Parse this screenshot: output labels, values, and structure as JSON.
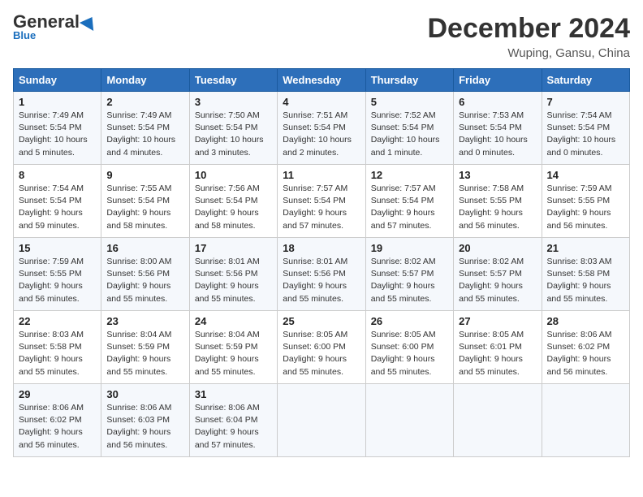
{
  "header": {
    "logo_general": "General",
    "logo_blue": "Blue",
    "month_title": "December 2024",
    "location": "Wuping, Gansu, China"
  },
  "days_of_week": [
    "Sunday",
    "Monday",
    "Tuesday",
    "Wednesday",
    "Thursday",
    "Friday",
    "Saturday"
  ],
  "weeks": [
    [
      {
        "day": "1",
        "sunrise": "7:49 AM",
        "sunset": "5:54 PM",
        "daylight": "10 hours and 5 minutes."
      },
      {
        "day": "2",
        "sunrise": "7:49 AM",
        "sunset": "5:54 PM",
        "daylight": "10 hours and 4 minutes."
      },
      {
        "day": "3",
        "sunrise": "7:50 AM",
        "sunset": "5:54 PM",
        "daylight": "10 hours and 3 minutes."
      },
      {
        "day": "4",
        "sunrise": "7:51 AM",
        "sunset": "5:54 PM",
        "daylight": "10 hours and 2 minutes."
      },
      {
        "day": "5",
        "sunrise": "7:52 AM",
        "sunset": "5:54 PM",
        "daylight": "10 hours and 1 minute."
      },
      {
        "day": "6",
        "sunrise": "7:53 AM",
        "sunset": "5:54 PM",
        "daylight": "10 hours and 0 minutes."
      },
      {
        "day": "7",
        "sunrise": "7:54 AM",
        "sunset": "5:54 PM",
        "daylight": "10 hours and 0 minutes."
      }
    ],
    [
      {
        "day": "8",
        "sunrise": "7:54 AM",
        "sunset": "5:54 PM",
        "daylight": "9 hours and 59 minutes."
      },
      {
        "day": "9",
        "sunrise": "7:55 AM",
        "sunset": "5:54 PM",
        "daylight": "9 hours and 58 minutes."
      },
      {
        "day": "10",
        "sunrise": "7:56 AM",
        "sunset": "5:54 PM",
        "daylight": "9 hours and 58 minutes."
      },
      {
        "day": "11",
        "sunrise": "7:57 AM",
        "sunset": "5:54 PM",
        "daylight": "9 hours and 57 minutes."
      },
      {
        "day": "12",
        "sunrise": "7:57 AM",
        "sunset": "5:54 PM",
        "daylight": "9 hours and 57 minutes."
      },
      {
        "day": "13",
        "sunrise": "7:58 AM",
        "sunset": "5:55 PM",
        "daylight": "9 hours and 56 minutes."
      },
      {
        "day": "14",
        "sunrise": "7:59 AM",
        "sunset": "5:55 PM",
        "daylight": "9 hours and 56 minutes."
      }
    ],
    [
      {
        "day": "15",
        "sunrise": "7:59 AM",
        "sunset": "5:55 PM",
        "daylight": "9 hours and 56 minutes."
      },
      {
        "day": "16",
        "sunrise": "8:00 AM",
        "sunset": "5:56 PM",
        "daylight": "9 hours and 55 minutes."
      },
      {
        "day": "17",
        "sunrise": "8:01 AM",
        "sunset": "5:56 PM",
        "daylight": "9 hours and 55 minutes."
      },
      {
        "day": "18",
        "sunrise": "8:01 AM",
        "sunset": "5:56 PM",
        "daylight": "9 hours and 55 minutes."
      },
      {
        "day": "19",
        "sunrise": "8:02 AM",
        "sunset": "5:57 PM",
        "daylight": "9 hours and 55 minutes."
      },
      {
        "day": "20",
        "sunrise": "8:02 AM",
        "sunset": "5:57 PM",
        "daylight": "9 hours and 55 minutes."
      },
      {
        "day": "21",
        "sunrise": "8:03 AM",
        "sunset": "5:58 PM",
        "daylight": "9 hours and 55 minutes."
      }
    ],
    [
      {
        "day": "22",
        "sunrise": "8:03 AM",
        "sunset": "5:58 PM",
        "daylight": "9 hours and 55 minutes."
      },
      {
        "day": "23",
        "sunrise": "8:04 AM",
        "sunset": "5:59 PM",
        "daylight": "9 hours and 55 minutes."
      },
      {
        "day": "24",
        "sunrise": "8:04 AM",
        "sunset": "5:59 PM",
        "daylight": "9 hours and 55 minutes."
      },
      {
        "day": "25",
        "sunrise": "8:05 AM",
        "sunset": "6:00 PM",
        "daylight": "9 hours and 55 minutes."
      },
      {
        "day": "26",
        "sunrise": "8:05 AM",
        "sunset": "6:00 PM",
        "daylight": "9 hours and 55 minutes."
      },
      {
        "day": "27",
        "sunrise": "8:05 AM",
        "sunset": "6:01 PM",
        "daylight": "9 hours and 55 minutes."
      },
      {
        "day": "28",
        "sunrise": "8:06 AM",
        "sunset": "6:02 PM",
        "daylight": "9 hours and 56 minutes."
      }
    ],
    [
      {
        "day": "29",
        "sunrise": "8:06 AM",
        "sunset": "6:02 PM",
        "daylight": "9 hours and 56 minutes."
      },
      {
        "day": "30",
        "sunrise": "8:06 AM",
        "sunset": "6:03 PM",
        "daylight": "9 hours and 56 minutes."
      },
      {
        "day": "31",
        "sunrise": "8:06 AM",
        "sunset": "6:04 PM",
        "daylight": "9 hours and 57 minutes."
      },
      null,
      null,
      null,
      null
    ]
  ],
  "labels": {
    "sunrise": "Sunrise:",
    "sunset": "Sunset:",
    "daylight": "Daylight:"
  }
}
